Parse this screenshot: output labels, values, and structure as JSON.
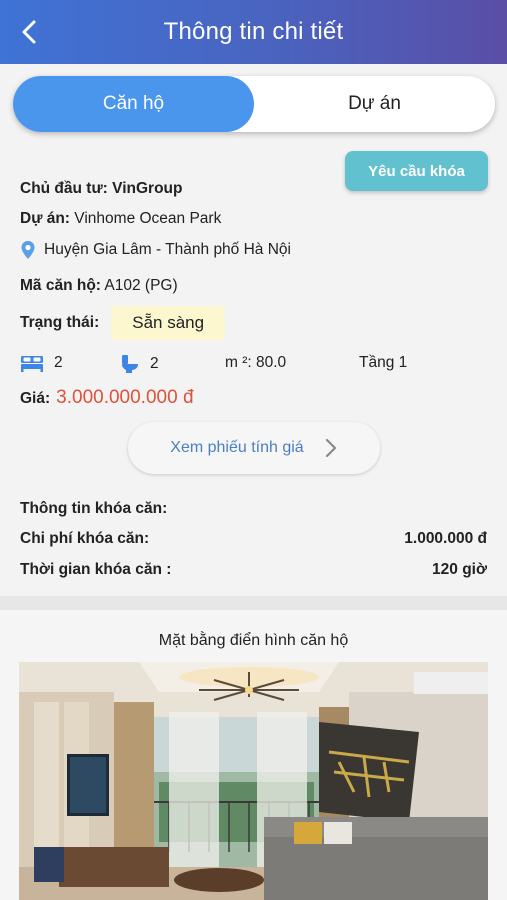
{
  "header": {
    "title": "Thông tin chi tiết",
    "back_icon": "chevron-left-icon"
  },
  "tabs": [
    {
      "label": "Căn hộ",
      "active": true
    },
    {
      "label": "Dự án",
      "active": false
    }
  ],
  "lock_request_label": "Yêu cầu khóa",
  "details": {
    "investor_label": "Chủ đầu tư:",
    "investor_value": "VinGroup",
    "project_label": "Dự án:",
    "project_value": "Vinhome Ocean Park",
    "location": "Huyện Gia Lâm - Thành phố Hà Nội",
    "code_label": "Mã căn hộ:",
    "code_value": "A102 (PG)",
    "status_label": "Trạng thái:",
    "status_value": "Sẵn sàng"
  },
  "specs": {
    "bedrooms": "2",
    "bathrooms": "2",
    "area_label": "m ²:",
    "area_value": "80.0",
    "floor": "Tầng 1"
  },
  "price": {
    "label": "Giá:",
    "value": "3.000.000.000 đ"
  },
  "view_quote_label": "Xem phiếu tính giá",
  "lock_info": {
    "title": "Thông tin khóa căn:",
    "fee_label": "Chi phí khóa căn:",
    "fee_value": "1.000.000 đ",
    "time_label": "Thời gian khóa căn :",
    "time_value": "120 giờ"
  },
  "floor_plan": {
    "title": "Mặt bằng điển hình căn hộ"
  },
  "colors": {
    "header_start": "#3f73d6",
    "header_end": "#5a4ea6",
    "tab_active": "#4a96ec",
    "lock_button": "#62c1cf",
    "price": "#e0503a",
    "link": "#4a7fc8",
    "status_bg": "#fdf7d0",
    "icon_blue": "#3d86e6"
  }
}
